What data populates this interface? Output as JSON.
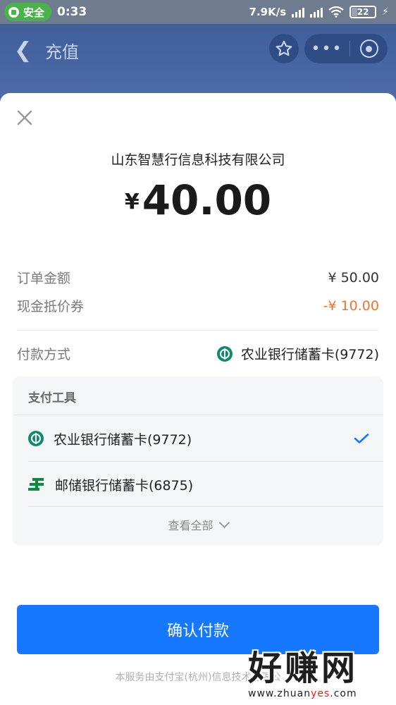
{
  "status_bar": {
    "safe_label": "安全",
    "time": "0:33",
    "network_speed": "7.9K/s",
    "battery": "22"
  },
  "header": {
    "title": "充值"
  },
  "sheet": {
    "merchant": "山东智慧行信息科技有限公司",
    "currency_symbol": "¥",
    "amount": "40.00",
    "order_amount_label": "订单金额",
    "order_amount_value": "¥ 50.00",
    "coupon_label": "现金抵价券",
    "coupon_value": "-¥ 10.00",
    "payment_method_label": "付款方式",
    "payment_method_value": "农业银行储蓄卡(9772)",
    "tools": {
      "heading": "支付工具",
      "items": [
        {
          "label": "农业银行储蓄卡(9772)",
          "icon": "abc-bank-icon",
          "selected": true
        },
        {
          "label": "邮储银行储蓄卡(6875)",
          "icon": "psbc-bank-icon",
          "selected": false
        }
      ],
      "view_all": "查看全部"
    },
    "confirm_label": "确认付款",
    "footer": "本服务由支付宝(杭州)信息技术有限公"
  },
  "watermark": {
    "text": "好赚网",
    "url_prefix": "www.zhuan",
    "url_highlight": "yes",
    "url_suffix": ".com"
  },
  "colors": {
    "accent": "#1677ff",
    "discount": "#f0742c",
    "safe_badge": "#49b24d"
  }
}
